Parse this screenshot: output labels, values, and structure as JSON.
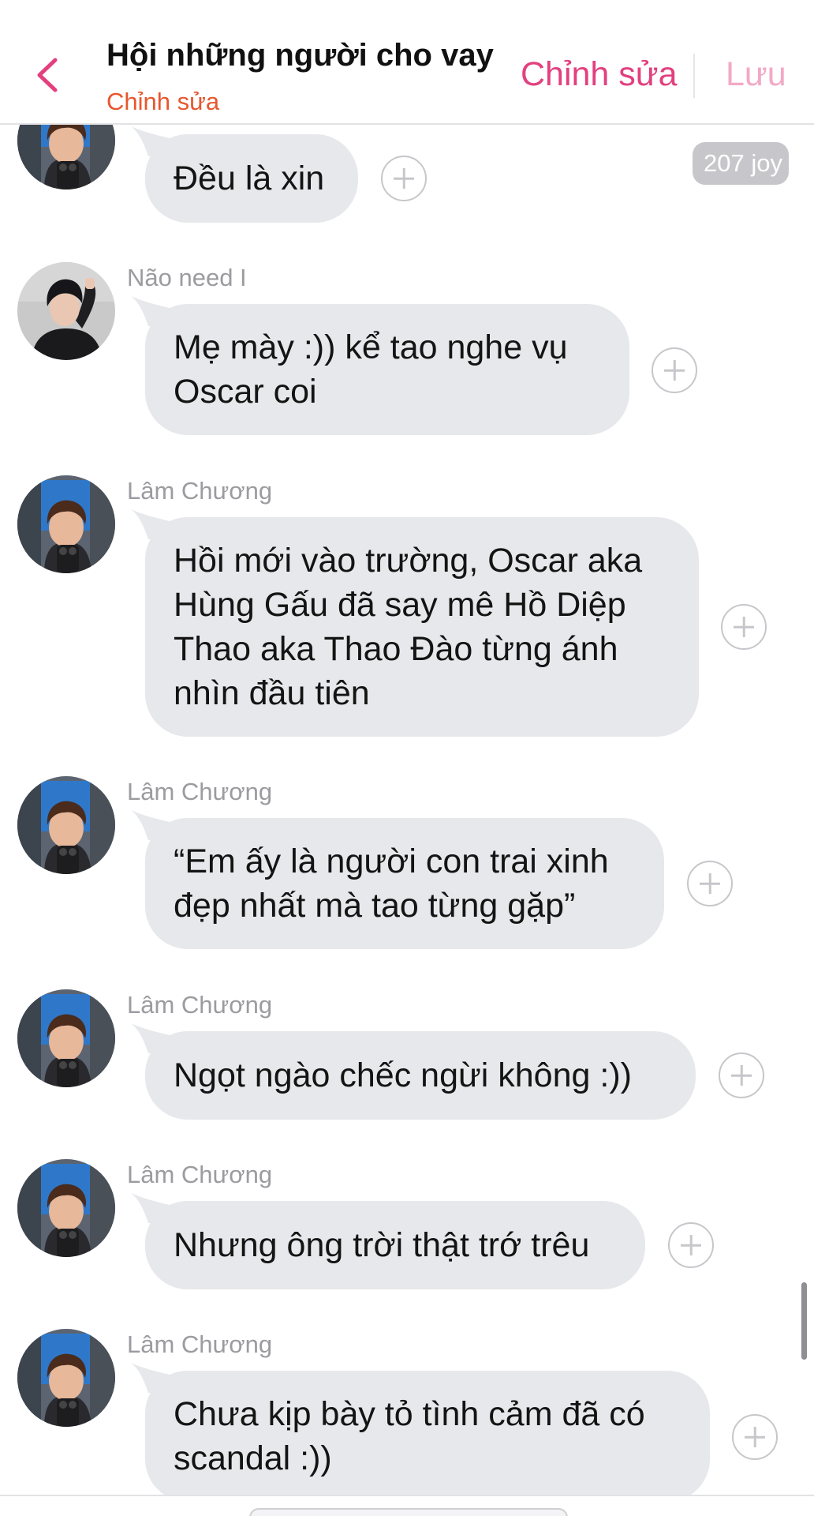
{
  "header": {
    "title": "Hội những người cho vay",
    "subtitle": "Chỉnh sửa",
    "edit_label": "Chỉnh sửa",
    "save_label": "Lưu"
  },
  "top_message": {
    "text": "Đều là xin",
    "reaction_count": "207 joy"
  },
  "messages": [
    {
      "sender": "Não need I",
      "text": "Mẹ mày :)) kể tao nghe vụ\nOscar coi"
    },
    {
      "sender": "Lâm Chương",
      "text": "Hồi mới vào trường, Oscar aka\nHùng Gấu đã say mê Hồ Diệp\nThao aka Thao Đào từng ánh\nnhìn đầu tiên"
    },
    {
      "sender": "Lâm Chương",
      "text": "“Em ấy là người con trai xinh\nđẹp nhất mà tao từng gặp”"
    },
    {
      "sender": "Lâm Chương",
      "text": "Ngọt ngào chếc ngừi không :))"
    },
    {
      "sender": "Lâm Chương",
      "text": "Nhưng ông trời thật trớ trêu"
    },
    {
      "sender": "Lâm Chương",
      "text": "Chưa kịp bày tỏ tình cảm đã có\nscandal :))"
    }
  ],
  "colors": {
    "accent": "#e2407f",
    "subtitle": "#e8562e",
    "bubble": "#e7e8eb"
  },
  "icons": {
    "back": "chevron-left-icon",
    "react": "plus-circle-icon"
  }
}
